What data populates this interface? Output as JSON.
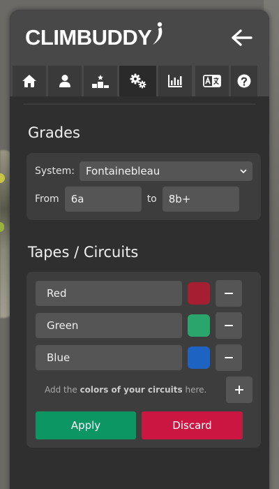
{
  "app": {
    "brand": "CLIMBUDDY"
  },
  "tabs": [
    {
      "name": "home",
      "icon": "home-icon",
      "active": false
    },
    {
      "name": "user",
      "icon": "user-icon",
      "active": false
    },
    {
      "name": "ranking",
      "icon": "podium-icon",
      "active": false
    },
    {
      "name": "settings",
      "icon": "gears-icon",
      "active": true
    },
    {
      "name": "stats",
      "icon": "chart-icon",
      "active": false
    },
    {
      "name": "language",
      "icon": "language-icon",
      "active": false
    },
    {
      "name": "help",
      "icon": "help-icon",
      "active": false
    }
  ],
  "grades": {
    "title": "Grades",
    "system_label": "System:",
    "system_value": "Fontainebleau",
    "from_label": "From",
    "from_value": "6a",
    "to_label": "to",
    "to_value": "8b+"
  },
  "circuits": {
    "title": "Tapes / Circuits",
    "items": [
      {
        "label": "Red",
        "color": "#a61e32"
      },
      {
        "label": "Green",
        "color": "#2aa66c"
      },
      {
        "label": "Blue",
        "color": "#1d64c2"
      }
    ],
    "hint_before": "Add the ",
    "hint_bold": "colors of your circuits",
    "hint_after": " here."
  },
  "actions": {
    "apply_label": "Apply",
    "discard_label": "Discard",
    "apply_color": "#0c9663",
    "discard_color": "#cc1642"
  }
}
